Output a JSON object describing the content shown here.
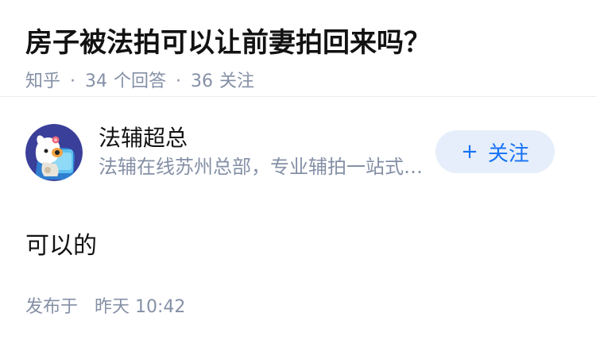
{
  "question": {
    "title": "房子被法拍可以让前妻拍回来吗？",
    "source": "知乎",
    "answer_count": "34",
    "answer_label": "个回答",
    "follower_count": "36",
    "follower_label": "关注"
  },
  "answer": {
    "author": {
      "name": "法辅超总",
      "bio": "法辅在线苏州总部，专业辅拍一站式服务",
      "avatar_icon": "cartoon-dog-avatar-icon"
    },
    "follow_button": {
      "icon": "plus-icon",
      "icon_glyph": "+",
      "label": "关注"
    },
    "content": "可以的",
    "publish_prefix": "发布于",
    "publish_time": "昨天 10:42"
  },
  "colors": {
    "title": "#121212",
    "meta": "#8590a6",
    "button_bg": "#e5eefa",
    "button_text": "#1772f6",
    "avatar_bg": "#3a3f99"
  }
}
